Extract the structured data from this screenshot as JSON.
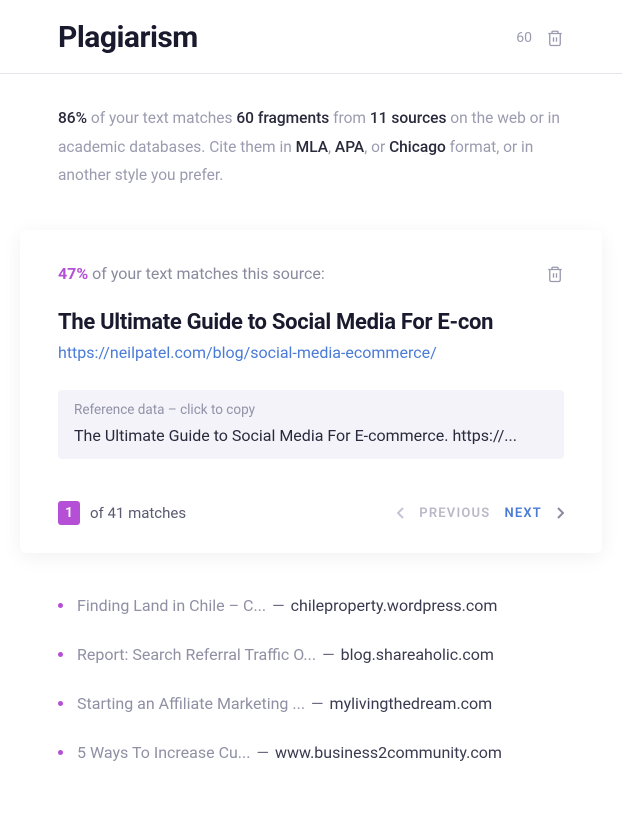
{
  "header": {
    "title": "Plagiarism",
    "count": "60"
  },
  "summary": {
    "pct": "86%",
    "t1": " of your text matches ",
    "frag": "60 fragments",
    "t2": " from ",
    "src": "11 sources",
    "t3": " on the web or in academic databases. Cite them in ",
    "mla": "MLA",
    "c1": ", ",
    "apa": "APA",
    "c2": ", or ",
    "chi": "Chicago",
    "t4": " format, or in another style you prefer."
  },
  "card": {
    "pct": "47%",
    "match_text": " of your text matches this source:",
    "source_title": "The Ultimate Guide to Social Media For E-con",
    "source_url": "https://neilpatel.com/blog/social-media-ecommerce/",
    "ref_label": "Reference data – click to copy",
    "ref_text": "The Ultimate Guide to Social Media For E-commerce. https://...",
    "pager_current": "1",
    "pager_total": "of 41 matches",
    "prev": "PREVIOUS",
    "next": "NEXT"
  },
  "list": [
    {
      "title": "Finding Land in Chile – C...",
      "domain": "chileproperty.wordpress.com"
    },
    {
      "title": "Report: Search Referral Traffic O...",
      "domain": "blog.shareaholic.com"
    },
    {
      "title": "Starting an Affiliate Marketing ...",
      "domain": "mylivingthedream.com"
    },
    {
      "title": "5 Ways To Increase Cu...",
      "domain": "www.business2community.com"
    }
  ],
  "sep": "  —  "
}
